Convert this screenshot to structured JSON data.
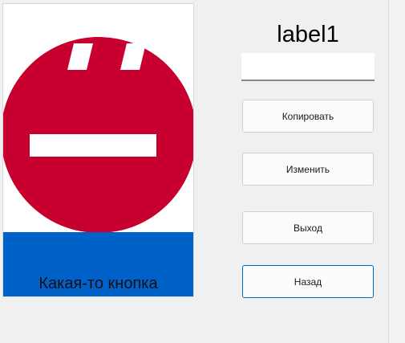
{
  "image_button": {
    "caption": "Какая-то кнопка",
    "icon": "neutral-face-sign-icon",
    "colors": {
      "face": "#c8002f",
      "band": "#0061c8",
      "features": "#ffffff"
    }
  },
  "label1": {
    "text": "label1"
  },
  "textbox": {
    "value": ""
  },
  "buttons": {
    "copy_label": "Копировать",
    "change_label": "Изменить",
    "exit_label": "Выход",
    "back_label": "Назад"
  },
  "colors": {
    "focus_border": "#0067c0"
  }
}
